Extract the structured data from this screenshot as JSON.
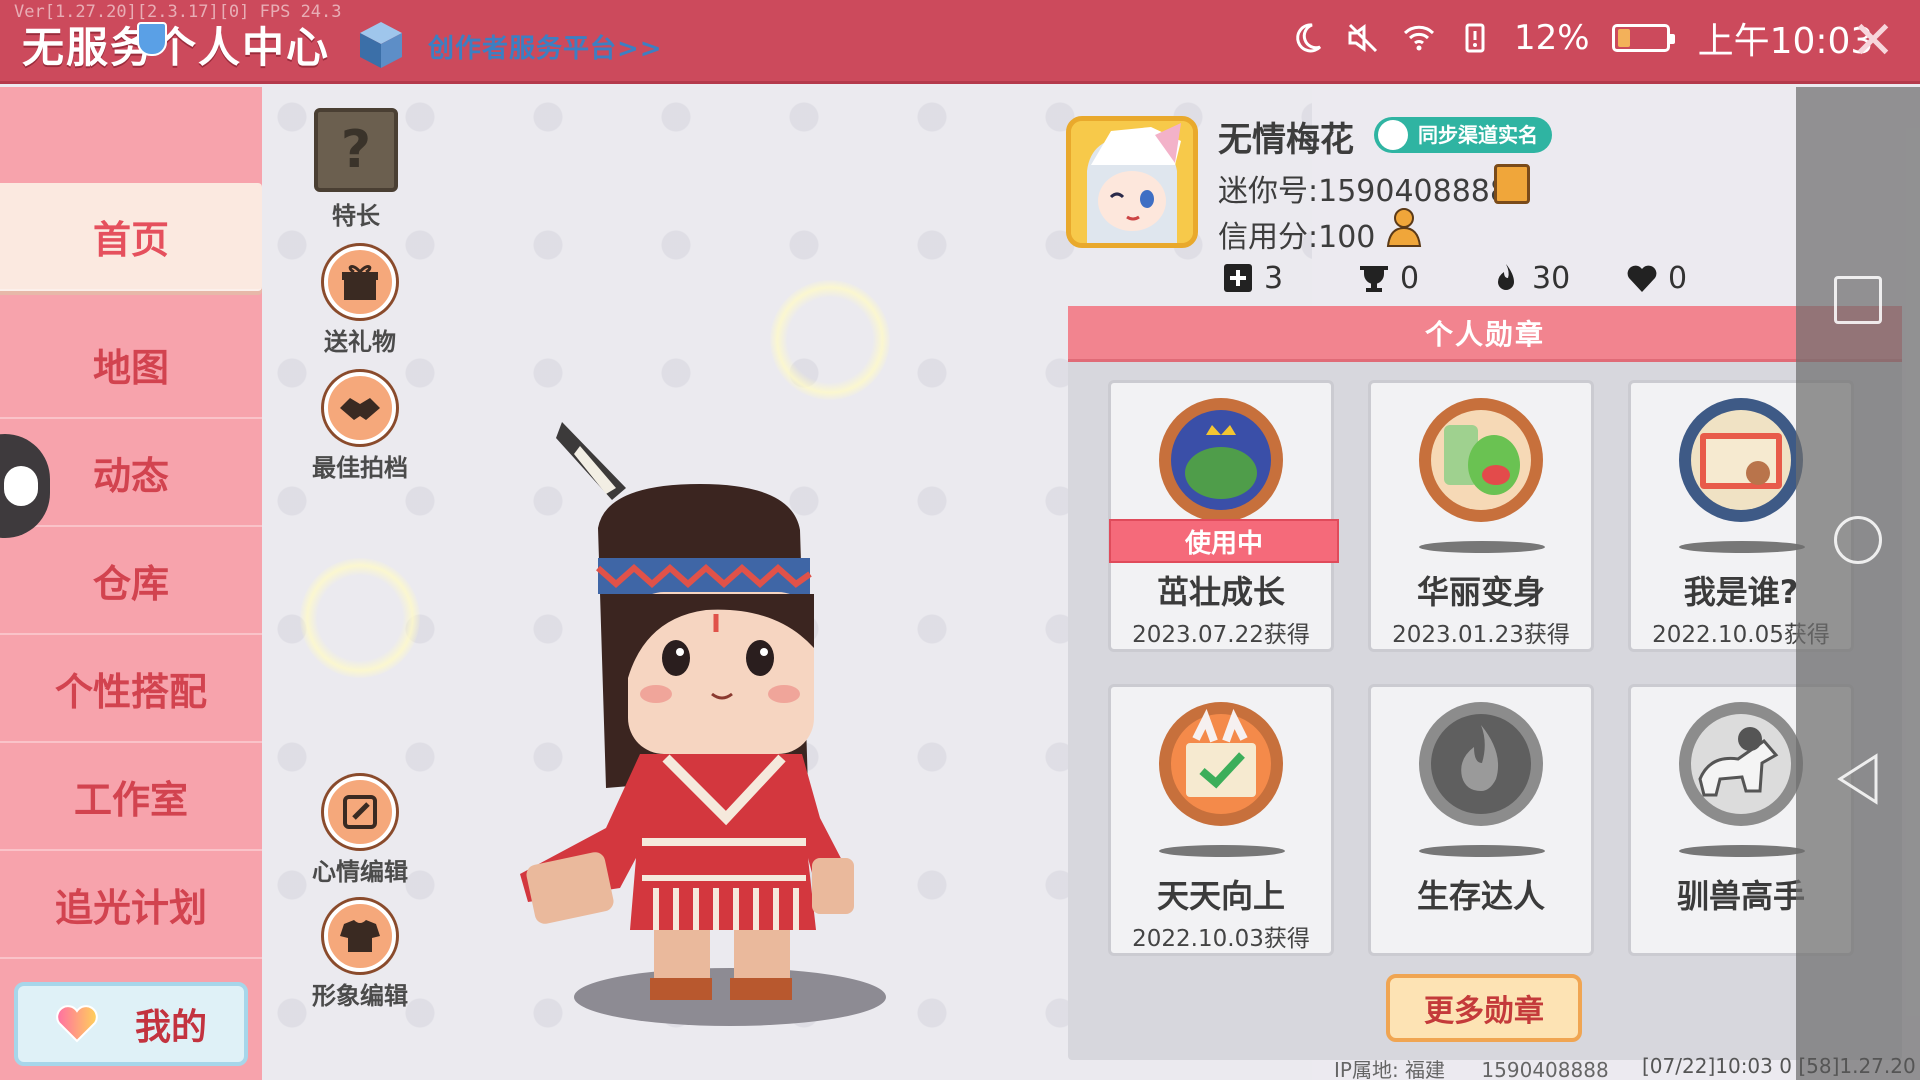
{
  "top_bar": {
    "debug_version": "Ver[1.27.20][2.3.17][0] FPS 24.3",
    "title": "无服务个人中心",
    "creator_link": "创作者服务平台>>",
    "battery_percent": "12%",
    "time": "上午10:03",
    "accent_color": "#cc4a5c"
  },
  "nav": {
    "items": [
      {
        "label": "首页",
        "active": true
      },
      {
        "label": "地图",
        "active": false
      },
      {
        "label": "动态",
        "active": false
      },
      {
        "label": "仓库",
        "active": false
      },
      {
        "label": "个性搭配",
        "active": false
      },
      {
        "label": "工作室",
        "active": false
      },
      {
        "label": "追光计划",
        "active": false
      }
    ],
    "mine_label": "我的"
  },
  "actions": {
    "talent": "特长",
    "send_gift": "送礼物",
    "best_photo": "最佳拍档",
    "mood_edit": "心情编辑",
    "image_edit": "形象编辑"
  },
  "profile": {
    "nickname": "无情梅花",
    "realname_badge": "同步渠道实名",
    "mini_id": "迷你号:1590408888",
    "credit": "信用分:100",
    "stats": {
      "plus": "3",
      "trophy": "0",
      "fire": "30",
      "heart": "0"
    }
  },
  "medals": {
    "header": "个人勋章",
    "using_label": "使用中",
    "items": [
      {
        "name": "茁壮成长",
        "date": "2023.07.22获得",
        "using": true,
        "icon": "frog-king-icon"
      },
      {
        "name": "华丽变身",
        "date": "2023.01.23获得",
        "using": false,
        "icon": "dino-mirror-icon"
      },
      {
        "name": "我是谁?",
        "date": "2022.10.05获得",
        "using": false,
        "icon": "postcard-icon"
      },
      {
        "name": "天天向上",
        "date": "2022.10.03获得",
        "using": false,
        "icon": "calendar-rabbit-icon"
      },
      {
        "name": "生存达人",
        "date": "",
        "using": false,
        "icon": "campfire-icon"
      },
      {
        "name": "驯兽高手",
        "date": "",
        "using": false,
        "icon": "horse-rider-icon"
      }
    ],
    "more_label": "更多勋章"
  },
  "footer": {
    "ip": "IP属地: 福建",
    "id": "1590408888",
    "info": "[07/22]10:03 0 [58]1.27.20"
  }
}
